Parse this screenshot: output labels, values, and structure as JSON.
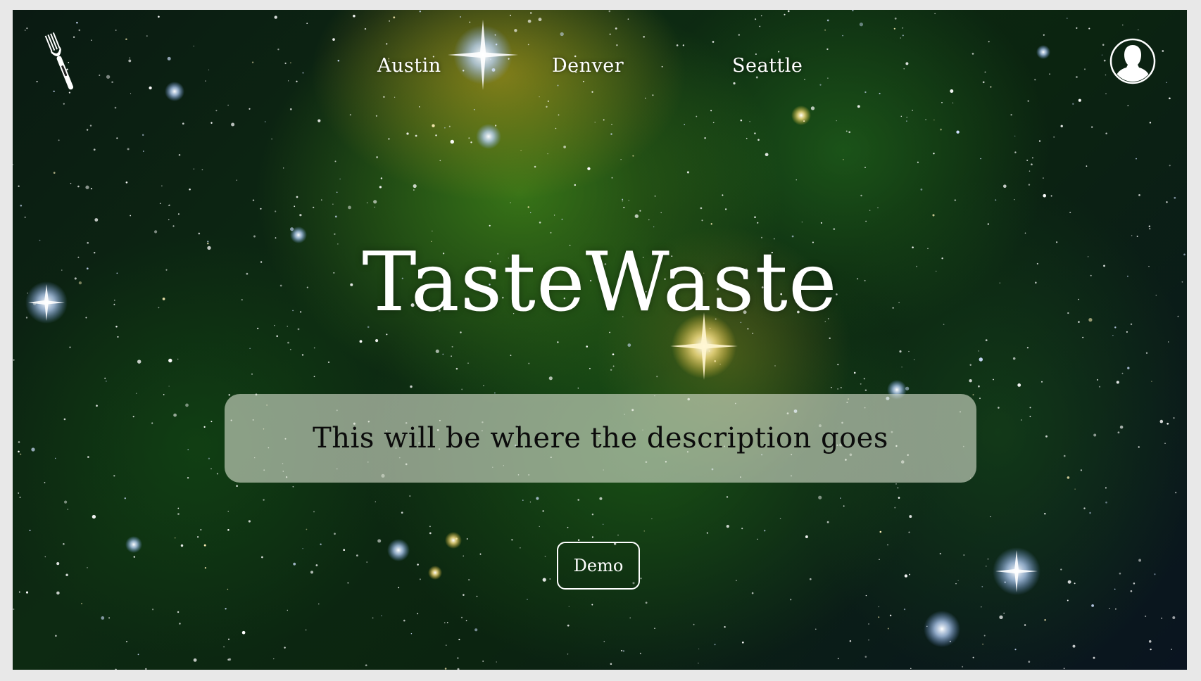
{
  "nav": {
    "links": [
      "Austin",
      "Denver",
      "Seattle"
    ],
    "logo_icon": "fork-icon",
    "profile_icon": "user-avatar-icon"
  },
  "hero": {
    "title": "TasteWaste",
    "description": "This will be where the description goes",
    "cta_label": "Demo"
  },
  "colors": {
    "text": "#ffffff",
    "description_box": "#d7decd",
    "description_text": "#0b0b0b",
    "background_dominant": "#0d2a12"
  }
}
